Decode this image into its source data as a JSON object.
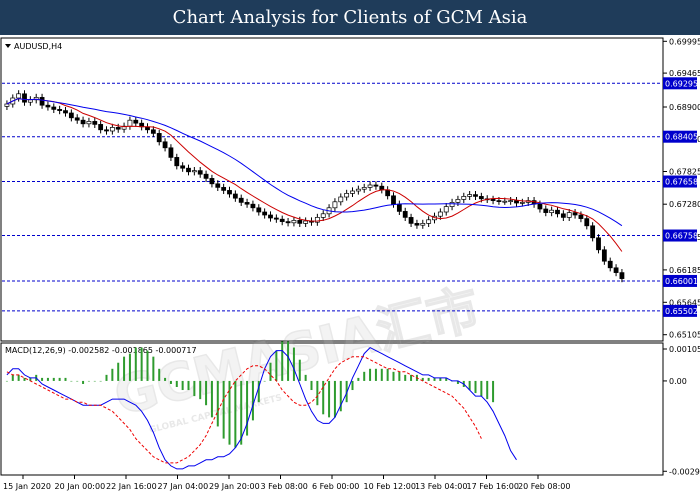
{
  "title": "Chart Analysis for Clients of GCM Asia",
  "watermark": {
    "main": "GCMASIA汇市",
    "sub": "GLOBAL CAPITAL MARKETS"
  },
  "colors": {
    "header_bg": "#1f3c5a",
    "level_line": "#0000cc",
    "tag_bg": "#0000cc",
    "ma_fast": "#cc0000",
    "ma_slow": "#0000ee",
    "bull": "#000000",
    "bear": "#000000",
    "macd_hist": "#2e9b2e",
    "macd_main": "#0000ee",
    "macd_signal": "#ee0000"
  },
  "chart_data": [
    {
      "type": "candlestick",
      "panel_label": "AUDUSD,H4",
      "y_ticks": [
        "0.69995",
        "0.69465",
        "0.68900",
        "0.68370",
        "0.67825",
        "0.67280",
        "0.66735",
        "0.66185",
        "0.65645",
        "0.65105"
      ],
      "ylim": [
        0.65,
        0.7005
      ],
      "x_ticks": [
        "15 Jan 2020",
        "20 Jan 00:00",
        "22 Jan 16:00",
        "27 Jan 04:00",
        "29 Jan 20:00",
        "3 Feb 08:00",
        "6 Feb 00:00",
        "10 Feb 12:00",
        "13 Feb 04:00",
        "17 Feb 16:00",
        "20 Feb 08:00"
      ],
      "levels": [
        "0.69295",
        "0.68405",
        "0.67658",
        "0.66758",
        "0.66001",
        "0.65502"
      ],
      "close": [
        0.6895,
        0.6905,
        0.6912,
        0.6898,
        0.6902,
        0.6906,
        0.6893,
        0.689,
        0.6886,
        0.6884,
        0.688,
        0.6872,
        0.6868,
        0.6862,
        0.6866,
        0.6861,
        0.6852,
        0.685,
        0.6856,
        0.6853,
        0.6858,
        0.6868,
        0.6863,
        0.6857,
        0.6852,
        0.6846,
        0.6832,
        0.6822,
        0.6806,
        0.6792,
        0.6788,
        0.6782,
        0.6784,
        0.6778,
        0.6771,
        0.6762,
        0.6756,
        0.6751,
        0.6745,
        0.6738,
        0.6731,
        0.6728,
        0.6722,
        0.6715,
        0.671,
        0.6705,
        0.6703,
        0.6699,
        0.6697,
        0.6701,
        0.6696,
        0.67,
        0.6698,
        0.6706,
        0.6712,
        0.6722,
        0.6732,
        0.674,
        0.6746,
        0.675,
        0.6753,
        0.6756,
        0.676,
        0.6758,
        0.6752,
        0.6742,
        0.6728,
        0.6716,
        0.6706,
        0.6696,
        0.6693,
        0.6696,
        0.6702,
        0.6708,
        0.6715,
        0.6724,
        0.6731,
        0.6736,
        0.6741,
        0.6744,
        0.6741,
        0.6737,
        0.6736,
        0.6734,
        0.6733,
        0.6733,
        0.6734,
        0.673,
        0.6731,
        0.6734,
        0.6728,
        0.672,
        0.6714,
        0.6718,
        0.6712,
        0.6706,
        0.6714,
        0.671,
        0.6704,
        0.6692,
        0.6672,
        0.6652,
        0.6633,
        0.6622,
        0.6614,
        0.6604
      ]
    },
    {
      "type": "macd",
      "panel_label": "MACD(12,26,9) -0.002582 -0.001865 -0.000717",
      "y_ticks": [
        "0.001052",
        "0.00",
        "-0.002977"
      ],
      "ylim": [
        -0.0031,
        0.00125
      ],
      "main": [
        0.0002,
        0.0004,
        0.0004,
        0.0002,
        0.0001,
        0.0001,
        -0.0001,
        -0.0002,
        -0.0003,
        -0.0004,
        -0.0005,
        -0.0006,
        -0.0007,
        -0.0008,
        -0.0008,
        -0.0008,
        -0.0008,
        -0.0007,
        -0.0006,
        -0.0006,
        -0.0006,
        -0.0007,
        -0.0008,
        -0.001,
        -0.0013,
        -0.0017,
        -0.0022,
        -0.0026,
        -0.0028,
        -0.0029,
        -0.0029,
        -0.0028,
        -0.0028,
        -0.0027,
        -0.0026,
        -0.0026,
        -0.0025,
        -0.0025,
        -0.0024,
        -0.0022,
        -0.0019,
        -0.0014,
        -0.0008,
        -0.0002,
        0.0004,
        0.0008,
        0.001,
        0.001,
        0.0008,
        0.0004,
        -0.0001,
        -0.0006,
        -0.001,
        -0.0013,
        -0.0014,
        -0.0014,
        -0.0012,
        -0.0008,
        -0.0004,
        0.0001,
        0.0005,
        0.0009,
        0.0011,
        0.001,
        0.0009,
        0.0008,
        0.0007,
        0.0006,
        0.0005,
        0.0004,
        0.0003,
        0.0002,
        0.0002,
        0.0001,
        0.0001,
        0.0001,
        0.0,
        0.0,
        -0.0001,
        -0.0003,
        -0.0005,
        -0.0005,
        -0.0007,
        -0.001,
        -0.0014,
        -0.0018,
        -0.0023,
        -0.0026
      ],
      "signal": [
        0.0003,
        0.0002,
        0.0002,
        0.0001,
        0.0,
        -0.0001,
        -0.0002,
        -0.0003,
        -0.0004,
        -0.0005,
        -0.0006,
        -0.0006,
        -0.0007,
        -0.0007,
        -0.0008,
        -0.0008,
        -0.0008,
        -0.0009,
        -0.001,
        -0.0012,
        -0.0014,
        -0.0016,
        -0.0019,
        -0.0021,
        -0.0023,
        -0.0025,
        -0.0026,
        -0.0027,
        -0.0027,
        -0.0027,
        -0.0026,
        -0.0025,
        -0.0023,
        -0.0021,
        -0.0018,
        -0.0014,
        -0.001,
        -0.0006,
        -0.0003,
        0.0,
        0.0002,
        0.0004,
        0.0005,
        0.0005,
        0.0004,
        0.0002,
        0.0,
        -0.0003,
        -0.0005,
        -0.0007,
        -0.0008,
        -0.0008,
        -0.0007,
        -0.0005,
        -0.0002,
        0.0001,
        0.0004,
        0.0006,
        0.0007,
        0.0008,
        0.0008,
        0.0008,
        0.0007,
        0.0006,
        0.0005,
        0.0004,
        0.0004,
        0.0003,
        0.0003,
        0.0002,
        0.0001,
        0.0,
        -0.0001,
        -0.0002,
        -0.0003,
        -0.0004,
        -0.0005,
        -0.0007,
        -0.0009,
        -0.0012,
        -0.0015,
        -0.0019
      ],
      "histogram": [
        0.0,
        0.0002,
        0.0002,
        0.0001,
        0.0001,
        0.0002,
        0.0001,
        0.0001,
        0.0001,
        0.0001,
        0.0001,
        0.0,
        0.0,
        -0.0001,
        0.0,
        0.0,
        0.0,
        0.0002,
        0.0004,
        0.0006,
        0.0008,
        0.0009,
        0.0011,
        0.0011,
        0.001,
        0.0008,
        0.0004,
        0.0001,
        -0.0001,
        -0.0002,
        -0.0003,
        -0.0003,
        -0.0005,
        -0.0006,
        -0.0008,
        -0.0012,
        -0.0015,
        -0.0019,
        -0.0021,
        -0.0022,
        -0.0021,
        -0.0018,
        -0.0013,
        -0.0007,
        0.0,
        0.0006,
        0.001,
        0.0013,
        0.0013,
        0.0011,
        0.0007,
        0.0002,
        -0.0003,
        -0.0008,
        -0.0011,
        -0.0012,
        -0.0012,
        -0.001,
        -0.0007,
        -0.0003,
        0.0001,
        0.0003,
        0.0004,
        0.0004,
        0.0004,
        0.0004,
        0.0003,
        0.0003,
        0.0002,
        0.0002,
        0.0002,
        0.0001,
        0.0001,
        0.0001,
        0.0001,
        0.0001,
        0.0,
        -0.0001,
        -0.0002,
        -0.0003,
        -0.0004,
        -0.0005,
        -0.0006,
        -0.0007
      ]
    }
  ]
}
